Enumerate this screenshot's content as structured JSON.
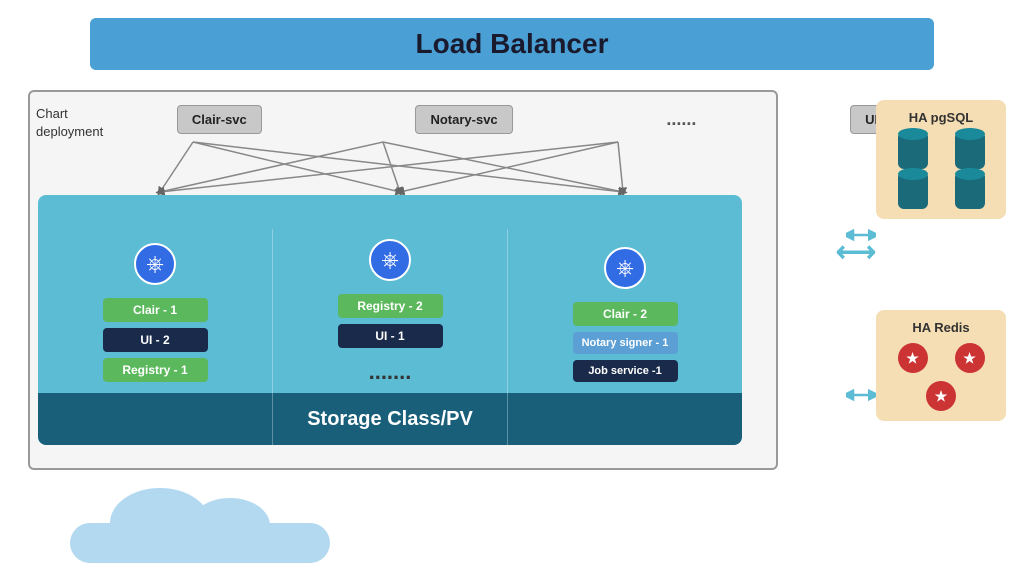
{
  "loadBalancer": {
    "label": "Load Balancer"
  },
  "chartDeployment": {
    "label": "Chart\ndeployment"
  },
  "services": {
    "items": [
      "Clair-svc",
      "Notary-svc",
      "UI-svc"
    ],
    "dots": "......."
  },
  "pods": [
    {
      "items": [
        {
          "label": "Clair - 1",
          "type": "green"
        },
        {
          "label": "UI - 2",
          "type": "dark"
        },
        {
          "label": "Registry - 1",
          "type": "green"
        }
      ]
    },
    {
      "dots": ".......",
      "items": [
        {
          "label": "Registry - 2",
          "type": "green"
        },
        {
          "label": "UI - 1",
          "type": "dark"
        }
      ]
    },
    {
      "items": [
        {
          "label": "Clair - 2",
          "type": "green"
        },
        {
          "label": "Notary signer - 1",
          "type": "blue"
        },
        {
          "label": "Job service -1",
          "type": "dark"
        }
      ]
    }
  ],
  "storage": {
    "label": "Storage Class/PV"
  },
  "haPgsql": {
    "title": "HA pgSQL"
  },
  "haRedis": {
    "title": "HA Redis"
  },
  "midDots": "......."
}
